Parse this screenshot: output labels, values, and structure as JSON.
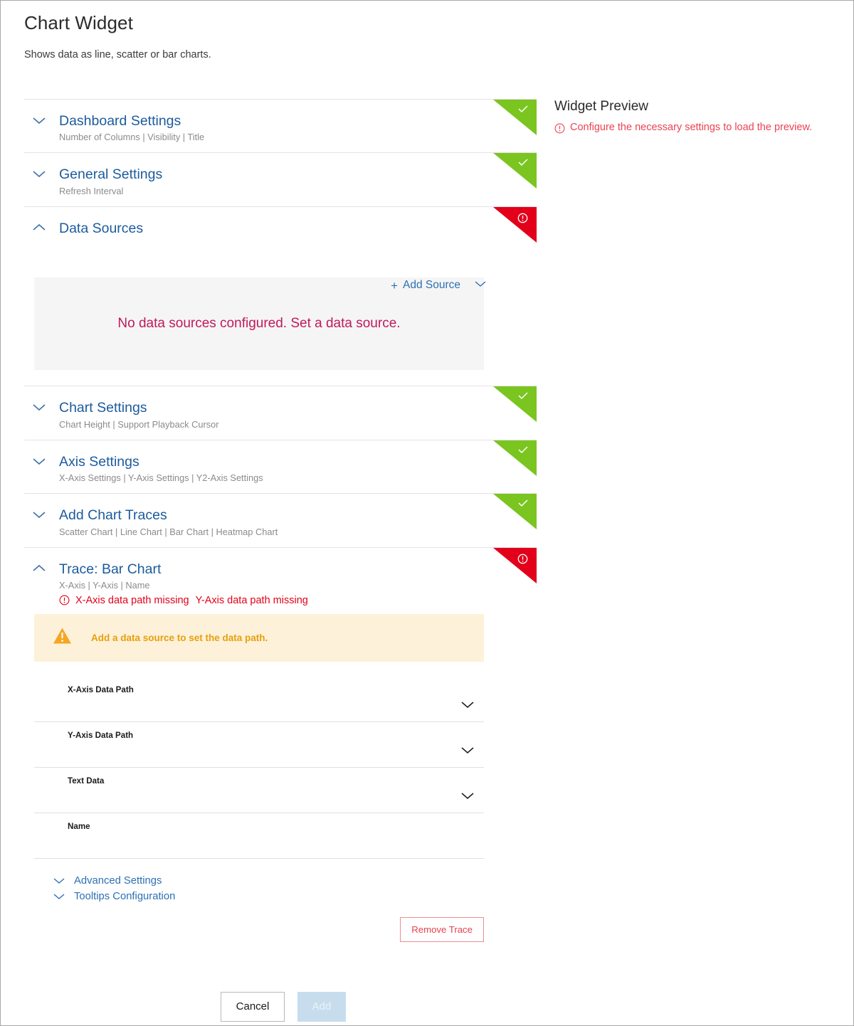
{
  "header": {
    "title": "Chart Widget",
    "subtitle": "Shows data as line, scatter or bar charts."
  },
  "colors": {
    "accent_blue": "#1c5b9c",
    "link_blue": "#2d70b3",
    "status_ok_green": "#7ac520",
    "status_error_red": "#e2001a",
    "error_text": "#ea4352",
    "magenta": "#c2185b",
    "warn_amber": "#e8a00c",
    "warn_bg": "#fdf1d9",
    "empty_bg": "#f5f5f5",
    "add_button_bg": "#c7dded"
  },
  "sections": [
    {
      "id": "dashboard-settings",
      "title": "Dashboard Settings",
      "subtitle": "Number of Columns | Visibility | Title",
      "status": "ok",
      "expanded": false,
      "chevron": "chevron-down-icon",
      "status_icon": "check-icon"
    },
    {
      "id": "general-settings",
      "title": "General Settings",
      "subtitle": "Refresh Interval",
      "status": "ok",
      "expanded": false,
      "chevron": "chevron-down-icon",
      "status_icon": "check-icon"
    },
    {
      "id": "data-sources",
      "title": "Data Sources",
      "subtitle": "",
      "status": "error",
      "expanded": true,
      "chevron": "chevron-up-icon",
      "status_icon": "exclamation-icon"
    },
    {
      "id": "chart-settings",
      "title": "Chart Settings",
      "subtitle": "Chart Height | Support Playback Cursor",
      "status": "ok",
      "expanded": false,
      "chevron": "chevron-down-icon",
      "status_icon": "check-icon"
    },
    {
      "id": "axis-settings",
      "title": "Axis Settings",
      "subtitle": "X-Axis Settings | Y-Axis Settings | Y2-Axis Settings",
      "status": "ok",
      "expanded": false,
      "chevron": "chevron-down-icon",
      "status_icon": "check-icon"
    },
    {
      "id": "add-chart-traces",
      "title": "Add Chart Traces",
      "subtitle": "Scatter Chart | Line Chart | Bar Chart | Heatmap Chart",
      "status": "ok",
      "expanded": false,
      "chevron": "chevron-down-icon",
      "status_icon": "check-icon"
    },
    {
      "id": "trace-bar-chart",
      "title": "Trace: Bar Chart",
      "subtitle": "X-Axis | Y-Axis | Name",
      "status": "error",
      "expanded": true,
      "chevron": "chevron-up-icon",
      "status_icon": "exclamation-icon"
    }
  ],
  "data_sources": {
    "add_source_label": "Add Source",
    "add_source_plus": "+",
    "add_source_chevron": "chevron-down-icon",
    "empty_message": "No data sources configured. Set a data source."
  },
  "trace": {
    "errors": [
      "X-Axis data path missing",
      "Y-Axis data path missing"
    ],
    "error_icon": "exclamation-circle-icon",
    "warning": {
      "icon": "warning-triangle-icon",
      "text": "Add a data source to set the data path."
    },
    "fields": [
      {
        "label": "X-Axis Data Path",
        "value": "",
        "placeholder": "",
        "has_dropdown": true
      },
      {
        "label": "Y-Axis Data Path",
        "value": "",
        "placeholder": "",
        "has_dropdown": true
      },
      {
        "label": "Text Data",
        "value": "",
        "placeholder": "",
        "has_dropdown": true
      },
      {
        "label": "Name",
        "value": "",
        "placeholder": "",
        "has_dropdown": false
      }
    ],
    "sub_sections": [
      {
        "label": "Advanced Settings",
        "chevron": "chevron-down-icon"
      },
      {
        "label": "Tooltips Configuration",
        "chevron": "chevron-down-icon"
      }
    ],
    "remove_label": "Remove Trace"
  },
  "footer": {
    "cancel_label": "Cancel",
    "add_label": "Add"
  },
  "preview": {
    "title": "Widget Preview",
    "message": "Configure the necessary settings to load the preview.",
    "message_icon": "exclamation-circle-icon"
  }
}
